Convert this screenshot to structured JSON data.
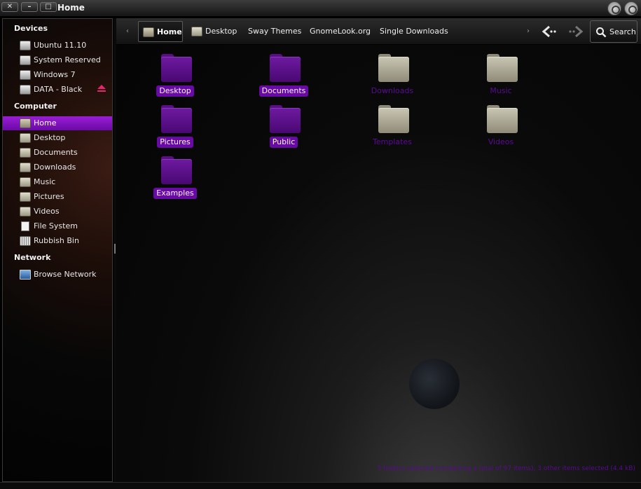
{
  "window": {
    "title": "Home",
    "close_glyph": "✕",
    "minimize_glyph": "–",
    "maximize_glyph": "□"
  },
  "sidebar": {
    "devices_heading": "Devices",
    "devices": [
      {
        "label": "Ubuntu 11.10",
        "icon": "drive-icon"
      },
      {
        "label": "System Reserved",
        "icon": "drive-icon"
      },
      {
        "label": "Windows 7",
        "icon": "drive-icon"
      },
      {
        "label": "DATA - Black",
        "icon": "drive-icon",
        "eject": true
      }
    ],
    "computer_heading": "Computer",
    "computer": [
      {
        "label": "Home",
        "icon": "home-folder-icon",
        "active": true
      },
      {
        "label": "Desktop",
        "icon": "folder-icon"
      },
      {
        "label": "Documents",
        "icon": "folder-icon"
      },
      {
        "label": "Downloads",
        "icon": "folder-icon"
      },
      {
        "label": "Music",
        "icon": "folder-icon"
      },
      {
        "label": "Pictures",
        "icon": "folder-icon"
      },
      {
        "label": "Videos",
        "icon": "folder-icon"
      },
      {
        "label": "File System",
        "icon": "file-icon"
      },
      {
        "label": "Rubbish Bin",
        "icon": "trash-icon"
      }
    ],
    "network_heading": "Network",
    "network": [
      {
        "label": "Browse Network",
        "icon": "network-icon"
      }
    ]
  },
  "toolbar": {
    "scroll_left_glyph": "‹",
    "scroll_right_glyph": "›",
    "breadcrumbs": [
      {
        "label": "Home",
        "active": true
      },
      {
        "label": "Desktop"
      },
      {
        "label": "Sway Themes"
      },
      {
        "label": "GnomeLook.org"
      },
      {
        "label": "Single Downloads"
      }
    ],
    "search_label": "Search"
  },
  "content": {
    "items": [
      {
        "label": "Desktop",
        "selected": true
      },
      {
        "label": "Documents",
        "selected": true
      },
      {
        "label": "Downloads",
        "selected": false
      },
      {
        "label": "Music",
        "selected": false
      },
      {
        "label": "Pictures",
        "selected": true
      },
      {
        "label": "Public",
        "selected": true
      },
      {
        "label": "Templates",
        "selected": false
      },
      {
        "label": "Videos",
        "selected": false
      },
      {
        "label": "Examples",
        "selected": true
      }
    ]
  },
  "status": {
    "text": "5 folders selected (containing a total of 97 items), 3 other items selected (4.4 kB)"
  },
  "colors": {
    "accent": "#6a0aa6",
    "unselected_label": "#5b0a96",
    "eject": "#e8246c"
  }
}
